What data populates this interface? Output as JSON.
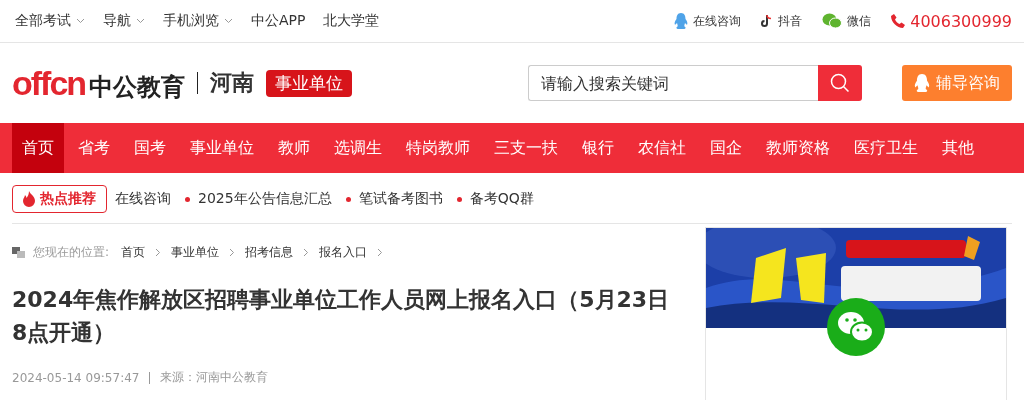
{
  "top_bar": {
    "links": [
      {
        "label": "全部考试",
        "dropdown": true
      },
      {
        "label": "导航",
        "dropdown": true
      },
      {
        "label": "手机浏览",
        "dropdown": true
      },
      {
        "label": "中公APP",
        "dropdown": false
      },
      {
        "label": "北大学堂",
        "dropdown": false
      }
    ],
    "contacts": [
      {
        "kind": "qq",
        "label": "在线咨询"
      },
      {
        "kind": "tiktok",
        "label": "抖音"
      },
      {
        "kind": "wechat",
        "label": "微信"
      },
      {
        "kind": "phone",
        "label": "4006300999"
      }
    ]
  },
  "header": {
    "logo_text": "offcn",
    "brand": "中公教育",
    "region": "河南",
    "channel": "事业单位",
    "search": {
      "placeholder": "请输入搜索关键词"
    },
    "consult_button": "辅导咨询"
  },
  "nav": [
    {
      "label": "首页",
      "selected": true
    },
    {
      "label": "省考",
      "selected": false
    },
    {
      "label": "国考",
      "selected": false
    },
    {
      "label": "事业单位",
      "selected": false
    },
    {
      "label": "教师",
      "selected": false
    },
    {
      "label": "选调生",
      "selected": false
    },
    {
      "label": "特岗教师",
      "selected": false
    },
    {
      "label": "三支一扶",
      "selected": false
    },
    {
      "label": "银行",
      "selected": false
    },
    {
      "label": "农信社",
      "selected": false
    },
    {
      "label": "国企",
      "selected": false
    },
    {
      "label": "教师资格",
      "selected": false
    },
    {
      "label": "医疗卫生",
      "selected": false
    },
    {
      "label": "其他",
      "selected": false
    }
  ],
  "hot": {
    "badge": "热点推荐",
    "links": [
      {
        "label": "在线咨询",
        "bullet": false
      },
      {
        "label": "2025年公告信息汇总",
        "bullet": true
      },
      {
        "label": "笔试备考图书",
        "bullet": true
      },
      {
        "label": "备考QQ群",
        "bullet": true
      }
    ]
  },
  "breadcrumb": {
    "prefix": "您现在的位置:",
    "items": [
      "首页",
      "事业单位",
      "招考信息",
      "报名入口"
    ]
  },
  "article": {
    "title": "2024年焦作解放区招聘事业单位工作人员网上报名入口（5月23日8点开通）",
    "date": "2024-05-14 09:57:47",
    "source": "来源：河南中公教育"
  }
}
